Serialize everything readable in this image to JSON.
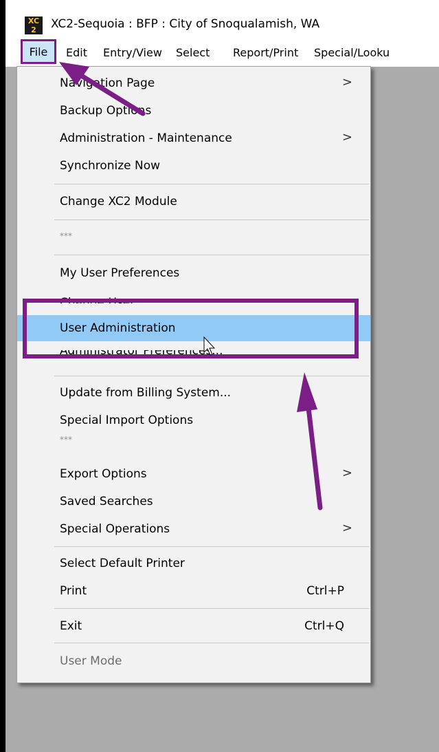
{
  "window": {
    "title": "XC2-Sequoia : BFP : City of Snoqualamish, WA",
    "icon": "xc2-app-icon",
    "icon_glyph_top": "XC",
    "icon_glyph_bottom": "2"
  },
  "menubar": {
    "items": [
      "File",
      "Edit",
      "Entry/View",
      "Select",
      "Report/Print",
      "Special/Looku"
    ],
    "active": "File"
  },
  "file_menu": {
    "items": [
      {
        "label": "Navigation Page",
        "submenu": true
      },
      {
        "label": "Backup Options"
      },
      {
        "label": "Administration - Maintenance",
        "submenu": true
      },
      {
        "label": "Synchronize Now"
      },
      {
        "label": "Change XC2 Module"
      },
      {
        "label": "***"
      },
      {
        "label": "My User Preferences"
      },
      {
        "label": "Change User"
      },
      {
        "label": "User Administration",
        "highlighted": true
      },
      {
        "label": "Administrator Preferences..."
      },
      {
        "label": "Update from Billing System..."
      },
      {
        "label": "Special Import Options"
      },
      {
        "label": "***"
      },
      {
        "label": "Export Options",
        "submenu": true
      },
      {
        "label": "Saved Searches"
      },
      {
        "label": "Special Operations",
        "submenu": true
      },
      {
        "label": "Select Default Printer"
      },
      {
        "label": "Print",
        "shortcut": "Ctrl+P"
      },
      {
        "label": "Exit",
        "shortcut": "Ctrl+Q"
      },
      {
        "label": "User Mode",
        "disabled": true
      }
    ],
    "submenu_arrow": ">"
  },
  "annotations": {
    "color": "#7b1f86",
    "highlight_color": "#91c9f7"
  }
}
